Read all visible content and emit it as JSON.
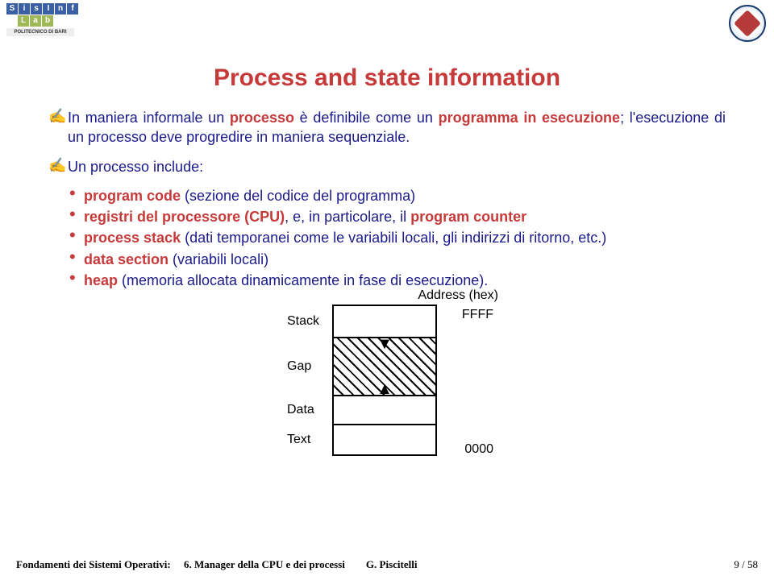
{
  "logo_left": {
    "letters": [
      "S",
      "i",
      "s",
      "I",
      "n",
      "f"
    ],
    "lab": [
      "L",
      "a",
      "b"
    ],
    "sub": "POLITECNICO DI BARI"
  },
  "title": "Process and state information",
  "para1_prefix": "In maniera informale un ",
  "para1_processo": "processo",
  "para1_mid1": " è definibile come un ",
  "para1_programma": "programma in esecuzione",
  "para1_mid2": "; l'esecuzione di un processo deve progredire in maniera sequenziale.",
  "para2_prefix": "Un processo include:",
  "items": {
    "a_label": "program code",
    "a_rest": " (sezione del codice del programma)",
    "b_label": "registri del processore (CPU)",
    "b_rest": ", e, in particolare, il ",
    "b_pc": "program counter",
    "c_label": "process stack",
    "c_rest": " (dati temporanei come le variabili locali, gli indirizzi di ritorno, etc.)",
    "d_label": "data section ",
    "d_rest": "(variabili locali)",
    "e_label": "heap",
    "e_rest": " (memoria allocata dinamicamente in fase di esecuzione)."
  },
  "diagram": {
    "addr_label": "Address (hex)",
    "addr_top": "FFFF",
    "addr_bot": "0000",
    "stack": "Stack",
    "gap": "Gap",
    "data": "Data",
    "text": "Text"
  },
  "footer": {
    "course": "Fondamenti dei Sistemi Operativi:",
    "chapter": "6.  Manager della CPU e dei processi",
    "author": "G. Piscitelli",
    "page": "9 / 58"
  }
}
